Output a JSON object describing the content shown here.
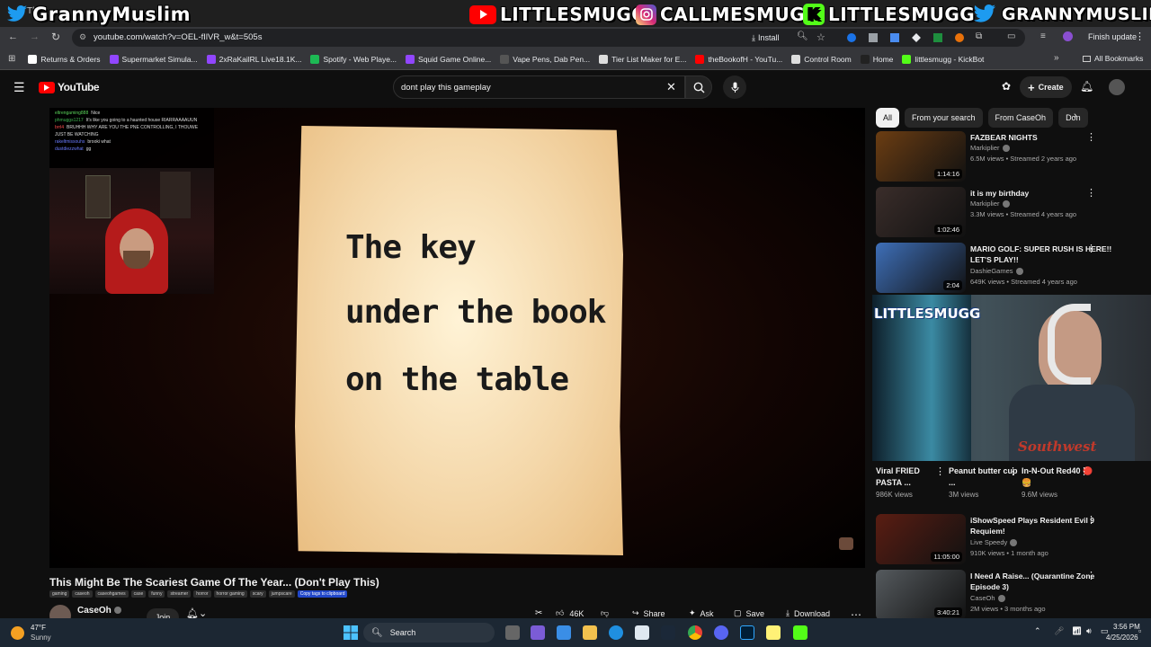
{
  "overlay": {
    "twitter_handle_left": "GrannyMuslim",
    "youtube_handle": "LITTLESMUGG",
    "instagram_handle": "CALLMESMUGG",
    "kick_handle": "LITTLESMUGG",
    "twitter_handle_right": "GRANNYMUSLIM"
  },
  "browser": {
    "url": "youtube.com/watch?v=OEL-fIlVR_w&t=505s",
    "install_label": "Install",
    "finish_update_label": "Finish update",
    "bookmarks": [
      {
        "label": "Returns & Orders",
        "color": "#ffffff"
      },
      {
        "label": "Supermarket Simula...",
        "color": "#9146ff"
      },
      {
        "label": "2xRaKailRL Live18.1K...",
        "color": "#9146ff"
      },
      {
        "label": "Spotify - Web Playe...",
        "color": "#1db954"
      },
      {
        "label": "Squid Game Online...",
        "color": "#9146ff"
      },
      {
        "label": "Vape Pens, Dab Pen...",
        "color": "#555555"
      },
      {
        "label": "Tier List Maker for E...",
        "color": "#dddddd"
      },
      {
        "label": "theBookofH - YouTu...",
        "color": "#ff0000"
      },
      {
        "label": "Control Room",
        "color": "#dddddd"
      },
      {
        "label": "Home",
        "color": "#222222"
      },
      {
        "label": "littlesmugg - KickBot",
        "color": "#53fc18"
      }
    ],
    "all_bookmarks_label": "All Bookmarks"
  },
  "youtube": {
    "logo_text": "YouTube",
    "search_value": "dont play this gameplay",
    "create_label": "Create",
    "chips": [
      "All",
      "From your search",
      "From CaseOh",
      "Don"
    ]
  },
  "player": {
    "note_lines": [
      "The key",
      "under the book",
      "on the table"
    ],
    "chat_lines": [
      {
        "user": "eltrengaming888",
        "msg": "Nice",
        "color": "#5ad35a"
      },
      {
        "user": "phmuggs1217",
        "msg": "It's like you going to a haunted house RIARRAAAAUUN",
        "color": "#3fb34f"
      },
      {
        "user": "brrl4",
        "msg": "BRUHHH WHY ARE YOU THE PNE CONTROLLING, I THOUWE JUST BE WATCHING",
        "color": "#ff4d4d"
      },
      {
        "user": "rakeltmissouhs",
        "msg": "brooki what",
        "color": "#6a7cff"
      },
      {
        "user": "dustdiezzwhat",
        "msg": "gg",
        "color": "#6a7cff"
      }
    ]
  },
  "video": {
    "title": "This Might Be The Scariest Game Of The Year... (Don't Play This)",
    "tags": [
      "gaming",
      "caseoh",
      "caseohgames",
      "case",
      "funny",
      "streamer",
      "horror",
      "horror gaming",
      "scary",
      "jumpscare"
    ],
    "copy_tags_label": "Copy tags to clipboard",
    "channel": "CaseOh",
    "join_label": "Join",
    "likes": "46K",
    "share_label": "Share",
    "ask_label": "Ask",
    "save_label": "Save",
    "download_label": "Download"
  },
  "recommendations": [
    {
      "title": "FAZBEAR NIGHTS",
      "channel": "Markiplier",
      "meta": "6.5M views • Streamed 2 years ago",
      "duration": "1:14:16",
      "thumb": "#6b3d12"
    },
    {
      "title": "it is my birthday",
      "channel": "Markiplier",
      "meta": "3.3M views • Streamed 4 years ago",
      "duration": "1:02:46",
      "thumb": "#3a2d2a"
    },
    {
      "title": "MARIO GOLF: SUPER RUSH IS HERE!! LET'S PLAY!!",
      "channel": "DashieGames",
      "meta": "649K views • Streamed 4 years ago",
      "duration": "2:04",
      "thumb": "#3e6fb8"
    },
    {
      "title": "iShowSpeed Plays Resident Evil 9 Requiem!",
      "channel": "Live Speedy",
      "meta": "910K views • 1 month ago",
      "duration": "11:05:00",
      "thumb": "#5a1d12"
    },
    {
      "title": "I Need A Raise... (Quarantine Zone Episode 3)",
      "channel": "CaseOh",
      "meta": "2M views • 3 months ago",
      "duration": "3:40:21",
      "thumb": "#555a5e"
    }
  ],
  "shorts": [
    {
      "title": "Viral FRIED PASTA ...",
      "views": "986K views"
    },
    {
      "title": "Peanut butter cup ...",
      "views": "3M views"
    },
    {
      "title": "In-N-Out Red40 🔴🍔",
      "views": "9.6M views"
    }
  ],
  "taskbar": {
    "temp": "47°F",
    "weather": "Sunny",
    "search_label": "Search",
    "time": "3:56 PM",
    "date": "4/25/2026"
  },
  "streamer_sign": "Southwest",
  "colors": {
    "youtube_red": "#ff0000",
    "accent": "#f1f1f1",
    "taskbar": "#1c2733"
  }
}
